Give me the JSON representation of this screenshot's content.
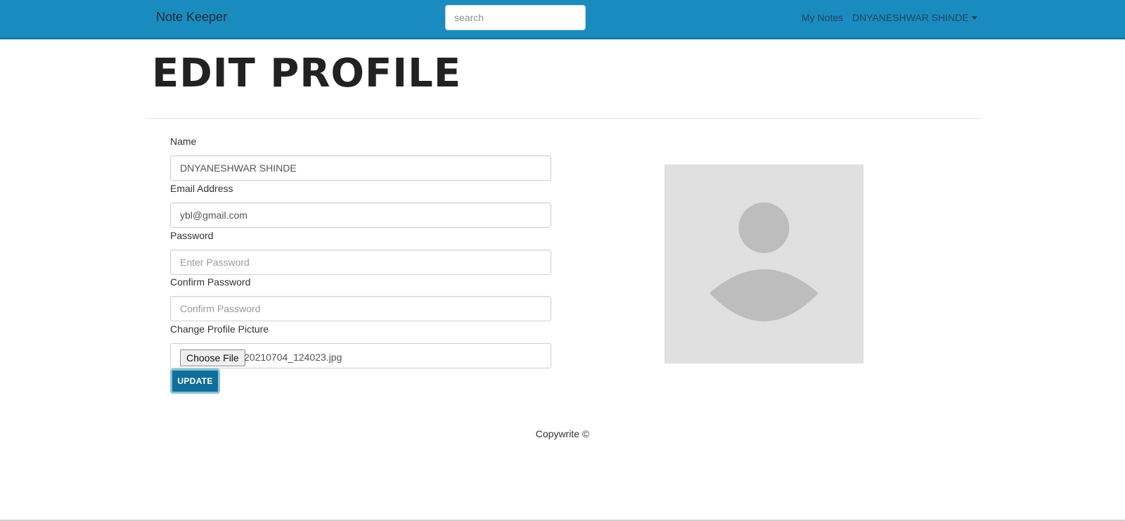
{
  "navbar": {
    "brand": "Note Keeper",
    "search_placeholder": "search",
    "my_notes_label": "My Notes",
    "user_name": "DNYANESHWAR SHINDE",
    "background_color": "#1a8bbf"
  },
  "page": {
    "title": "EDIT PROFILE"
  },
  "form": {
    "name_label": "Name",
    "name_value": "DNYANESHWAR SHINDE",
    "email_label": "Email Address",
    "email_value": "ybl@gmail.com",
    "password_label": "Password",
    "password_placeholder": "Enter Password",
    "confirm_label": "Confirm Password",
    "confirm_placeholder": "Confirm Password",
    "picture_label": "Change Profile Picture",
    "choose_file_label": "Choose File",
    "file_name": "20210704_124023.jpg",
    "update_label": "UPDATE",
    "update_color": "#106f9a"
  },
  "profile": {
    "avatar_icon": "user-placeholder-icon"
  },
  "footer": {
    "text": "Copywrite ©"
  }
}
